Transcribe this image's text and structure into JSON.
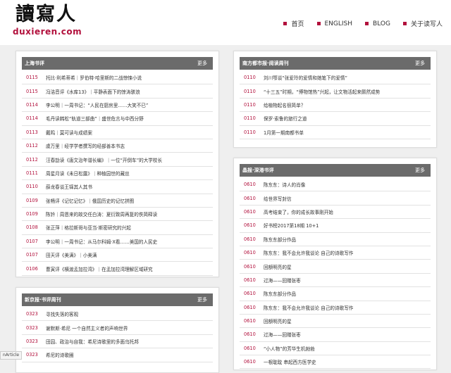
{
  "site": {
    "logo_cn": "讀寫人",
    "logo_en": "duxieren.com"
  },
  "nav": [
    {
      "label": "首页"
    },
    {
      "label": "ENGLISH"
    },
    {
      "label": "BLOG"
    },
    {
      "label": "关于读写人"
    }
  ],
  "colors": {
    "accent": "#b2103c",
    "panel_header": "#6b6b6b"
  },
  "panels": {
    "shanghai": {
      "title": "上海书评",
      "more": "更多",
      "items": [
        {
          "num": "0115",
          "text": "托比·利希蒂希｜罗伯特·哈里斯的二战惊悚小说"
        },
        {
          "num": "0115",
          "text": "冯洁音评《水库13》｜平静表面下的惊涛骇浪"
        },
        {
          "num": "0114",
          "text": "李公明｜一周书记：“人民在厨房里……大笑不已”"
        },
        {
          "num": "0114",
          "text": "毛丹读韩松“轨道三部曲”｜盛世危言与中西分野"
        },
        {
          "num": "0113",
          "text": "戴鸣｜莫可读与成绩案"
        },
        {
          "num": "0112",
          "text": "虞万里｜经学学者撰写的经部善本书志"
        },
        {
          "num": "0112",
          "text": "汪春劼读《唐文治年谱长编》｜一位“开倒车”的大学校长"
        },
        {
          "num": "0111",
          "text": "周星月读《未日松露》｜种植园世的藏丝"
        },
        {
          "num": "0110",
          "text": "薛龙春谈王铎其人其书"
        },
        {
          "num": "0109",
          "text": "张畅评《记忆记忆》｜俄国历史的记忆拼图"
        },
        {
          "num": "0109",
          "text": "陈钤｜周恩来的故交任白涛：夏衍致周再复的佚简释读"
        },
        {
          "num": "0108",
          "text": "张正萍｜格拉斯哥与亚当·斯密研究的兴起"
        },
        {
          "num": "0107",
          "text": "李公明｜一周书记：从马尔科姆·X看……美国的人民史"
        },
        {
          "num": "0107",
          "text": "田天评《美满》｜小美满"
        },
        {
          "num": "0106",
          "text": "曹寅评《横渡孟加拉湾》｜在孟加拉湾理解区域研究"
        }
      ]
    },
    "nanfang": {
      "title": "南方都市报·阅读周刊",
      "more": "更多",
      "items": [
        {
          "num": "0110",
          "text": "刘川鄂谈“张爱玲的爱情和她笔下的爱情”"
        },
        {
          "num": "0110",
          "text": "“十三五”时期，“博物馆热”兴起，让文物活起来颇然成势"
        },
        {
          "num": "0110",
          "text": "给植物起名很简单？"
        },
        {
          "num": "0110",
          "text": "保罗·索鲁的旅行之道"
        },
        {
          "num": "0110",
          "text": "1月第一期南都书单"
        }
      ]
    },
    "jingbao": {
      "title": "晶报·深港书评",
      "more": "更多",
      "items": [
        {
          "num": "0610",
          "text": "陈东东：诗人的肖像"
        },
        {
          "num": "0610",
          "text": "给世界写封信"
        },
        {
          "num": "0610",
          "text": "高考结束了，你的成长故事刚开始"
        },
        {
          "num": "0610",
          "text": "好书榜2017第18期 10+1"
        },
        {
          "num": "0610",
          "text": "陈东东部分作品"
        },
        {
          "num": "0610",
          "text": "陈东东：我不会允许我谈论 自己的诗歌写作"
        },
        {
          "num": "0610",
          "text": "回额明亮的星"
        },
        {
          "num": "0610",
          "text": "过海——回赠张枣"
        },
        {
          "num": "0610",
          "text": "陈东东部分作品"
        },
        {
          "num": "0610",
          "text": "陈东东：我不会允许我谈论 自己的诗歌写作"
        },
        {
          "num": "0610",
          "text": "回额明亮的星"
        },
        {
          "num": "0610",
          "text": "过海——回赠张枣"
        },
        {
          "num": "0610",
          "text": "“小人物”的芳华生机勃勃"
        },
        {
          "num": "0610",
          "text": "一根耽耽 串起西方医学史"
        }
      ]
    },
    "xinjing": {
      "title": "新京报·书评周刊",
      "more": "更多",
      "items": [
        {
          "num": "0323",
          "text": "寻找失落的客观"
        },
        {
          "num": "0323",
          "text": "谢默斯·希尼 一个自然主义者的声响世界"
        },
        {
          "num": "0323",
          "text": "田园、政治与自我：希尼诗歌里的多面乌托邦"
        },
        {
          "num": "0323",
          "text": "希尼的诗歌圈"
        }
      ]
    }
  },
  "status_bar": "nArticle"
}
